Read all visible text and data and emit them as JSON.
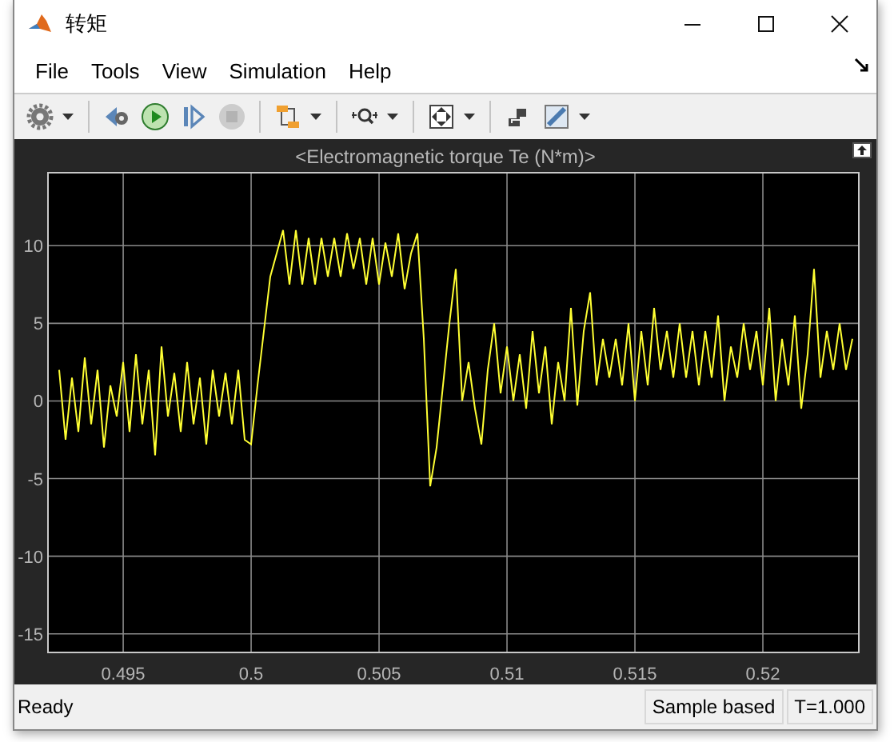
{
  "window": {
    "title": "转矩"
  },
  "menu": [
    {
      "label": "File"
    },
    {
      "label": "Tools"
    },
    {
      "label": "View"
    },
    {
      "label": "Simulation"
    },
    {
      "label": "Help"
    }
  ],
  "toolbar": [
    {
      "items": [
        {
          "dropdown": true,
          "disabled": false
        }
      ]
    },
    {
      "items": [
        {
          "dropdown": false,
          "disabled": false
        },
        {
          "dropdown": false,
          "disabled": false
        },
        {
          "dropdown": false,
          "disabled": false
        },
        {
          "dropdown": false,
          "disabled": true
        }
      ]
    },
    {
      "items": [
        {
          "dropdown": true,
          "disabled": false
        }
      ]
    },
    {
      "items": [
        {
          "dropdown": true,
          "disabled": false
        }
      ]
    },
    {
      "items": [
        {
          "dropdown": true,
          "disabled": false
        }
      ]
    },
    {
      "items": [
        {
          "dropdown": false,
          "disabled": false
        },
        {
          "dropdown": true,
          "disabled": false
        }
      ]
    }
  ],
  "scope": {
    "chart_data": {
      "type": "line",
      "title": "<Electromagnetic torque Te (N*m)>",
      "x": [
        0.4925,
        0.49275,
        0.493,
        0.49325,
        0.4935,
        0.49375,
        0.494,
        0.49425,
        0.4945,
        0.49475,
        0.495,
        0.49525,
        0.4955,
        0.49575,
        0.496,
        0.49625,
        0.4965,
        0.49675,
        0.497,
        0.49725,
        0.4975,
        0.49775,
        0.498,
        0.49825,
        0.4985,
        0.49875,
        0.499,
        0.49925,
        0.4995,
        0.49975,
        0.5,
        0.50025,
        0.5005,
        0.50075,
        0.501,
        0.50125,
        0.5015,
        0.50175,
        0.502,
        0.50225,
        0.5025,
        0.50275,
        0.503,
        0.50325,
        0.5035,
        0.50375,
        0.504,
        0.50425,
        0.5045,
        0.50475,
        0.505,
        0.50525,
        0.5055,
        0.50575,
        0.506,
        0.50625,
        0.5065,
        0.50675,
        0.507,
        0.50725,
        0.5075,
        0.50775,
        0.508,
        0.50825,
        0.5085,
        0.50875,
        0.509,
        0.50925,
        0.5095,
        0.50975,
        0.51,
        0.51025,
        0.5105,
        0.51075,
        0.511,
        0.51125,
        0.5115,
        0.51175,
        0.512,
        0.51225,
        0.5125,
        0.51275,
        0.513,
        0.51325,
        0.5135,
        0.51375,
        0.514,
        0.51425,
        0.5145,
        0.51475,
        0.515,
        0.51525,
        0.5155,
        0.51575,
        0.516,
        0.51625,
        0.5165,
        0.51675,
        0.517,
        0.51725,
        0.5175,
        0.51775,
        0.518,
        0.51825,
        0.5185,
        0.51875,
        0.519,
        0.51925,
        0.5195,
        0.51975,
        0.52,
        0.52025,
        0.5205,
        0.52075,
        0.521,
        0.52125,
        0.5215,
        0.52175,
        0.522,
        0.52225,
        0.5225,
        0.52275,
        0.523,
        0.52325,
        0.5235
      ],
      "grid": true,
      "series": [
        {
          "color": "#ffff33",
          "values": [
            2,
            -2.5,
            1.5,
            -2,
            2.8,
            -1.5,
            2,
            -3,
            1,
            -1,
            2.5,
            -2,
            3,
            -1.5,
            2,
            -3.5,
            3.5,
            -1,
            1.8,
            -2,
            2.5,
            -1.5,
            1.5,
            -2.8,
            2,
            -1,
            1.8,
            -1.5,
            2,
            -2.5,
            -2.8,
            1,
            4.5,
            8,
            9.5,
            11,
            7.5,
            11,
            7.5,
            10.5,
            7.5,
            10.5,
            8,
            10.5,
            8,
            10.8,
            8.5,
            10.5,
            7.5,
            10.5,
            7.5,
            10.2,
            8,
            10.8,
            7.2,
            9.5,
            10.8,
            4,
            -5.5,
            -3,
            1,
            5,
            8.5,
            0,
            2.5,
            -0.5,
            -2.8,
            2,
            5,
            0.5,
            3.5,
            0,
            3,
            -0.5,
            4.5,
            0.5,
            3.5,
            -1.5,
            2.5,
            0,
            6,
            -0.3,
            4.5,
            7,
            1,
            4,
            1.5,
            4,
            1,
            5,
            0,
            4.5,
            1,
            6,
            2,
            4.5,
            1.5,
            5,
            1.5,
            4.5,
            1,
            4.5,
            1.5,
            5.5,
            0,
            3.5,
            1.5,
            5,
            2,
            4.5,
            1,
            6,
            0,
            4,
            1,
            5.5,
            -0.5,
            3,
            8.5,
            1.5,
            4.5,
            2,
            5,
            2,
            4
          ]
        }
      ],
      "xlim": [
        0.49206,
        0.52375
      ],
      "ylim": [
        -16.2,
        14.7
      ],
      "xticks": [
        0.495,
        0.5,
        0.505,
        0.51,
        0.515,
        0.52
      ],
      "yticks": [
        -15,
        -10,
        -5,
        0,
        5,
        10
      ]
    }
  },
  "status_bar": {
    "message": "Ready",
    "fields": [
      "Sample based",
      "T=1.000"
    ]
  }
}
